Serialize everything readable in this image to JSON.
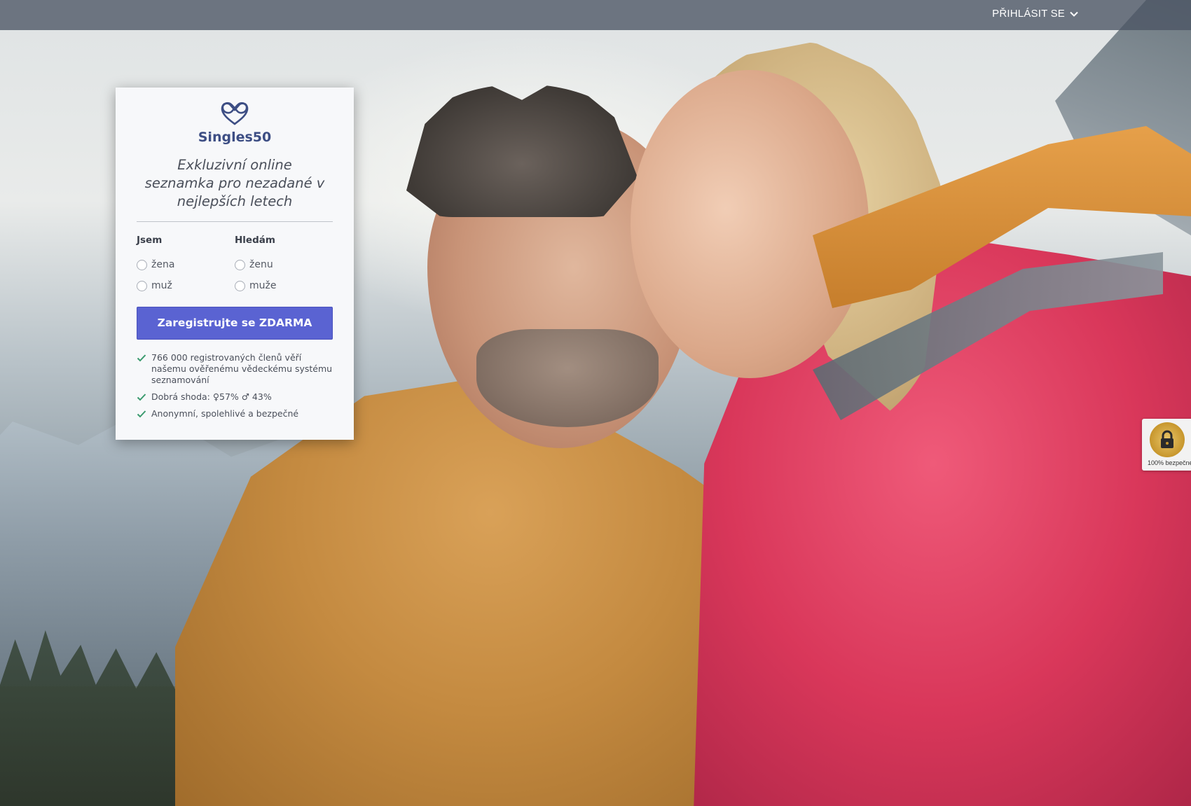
{
  "topbar": {
    "login_label": "PŘIHLÁSIT SE",
    "login_icon": "chevron-down-icon"
  },
  "brand": {
    "name": "Singles50",
    "logo_icon": "heart-infinity-logo",
    "color": "#3d4e84"
  },
  "tagline": "Exkluzivní online seznamka pro nezadané v nejlepších letech",
  "form": {
    "i_am": {
      "label": "Jsem",
      "options": [
        "žena",
        "muž"
      ]
    },
    "looking_for": {
      "label": "Hledám",
      "options": [
        "ženu",
        "muže"
      ]
    },
    "submit_label": "Zaregistrujte se ZDARMA",
    "submit_color": "#5a63d2"
  },
  "benefits": [
    "766 000 registrovaných členů věří našemu ověřenému vědeckému systému seznamování",
    "Dobrá shoda: ♀57% ♂ 43%",
    "Anonymní, spolehlivé a bezpečné"
  ],
  "check_color": "#3a9a6e",
  "security_seal": {
    "text": "100% bezpečné",
    "icon": "lock-icon"
  }
}
